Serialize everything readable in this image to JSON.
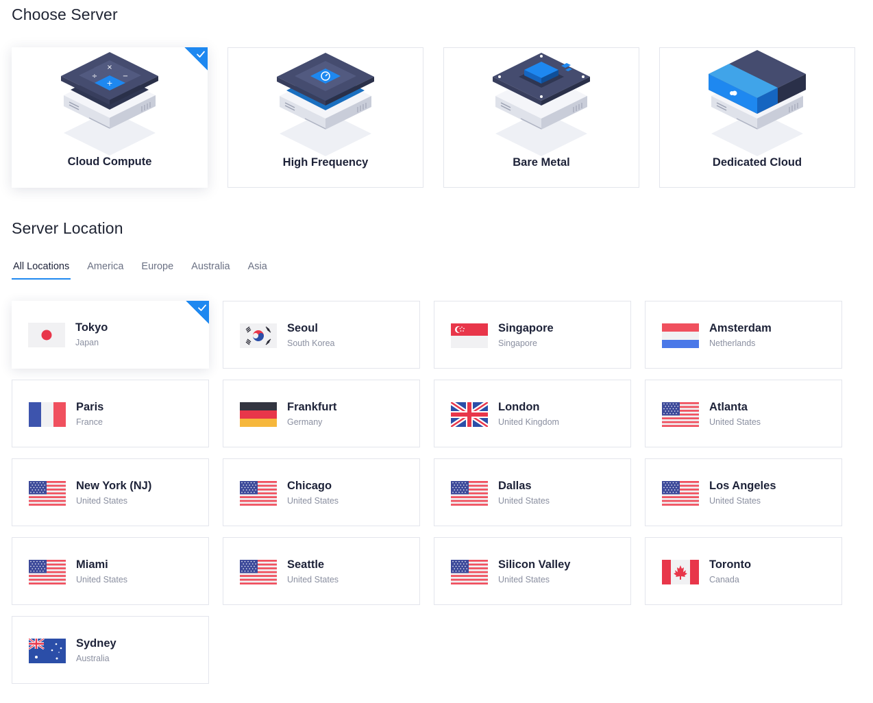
{
  "server_section": {
    "title": "Choose Server",
    "types": [
      {
        "label": "Cloud Compute",
        "selected": true
      },
      {
        "label": "High Frequency",
        "selected": false
      },
      {
        "label": "Bare Metal",
        "selected": false
      },
      {
        "label": "Dedicated Cloud",
        "selected": false
      }
    ]
  },
  "location_section": {
    "title": "Server Location",
    "tabs": [
      "All Locations",
      "America",
      "Europe",
      "Australia",
      "Asia"
    ],
    "active_tab": "All Locations",
    "locations": [
      {
        "city": "Tokyo",
        "country": "Japan",
        "flag": "jp-flag-icon",
        "selected": true
      },
      {
        "city": "Seoul",
        "country": "South Korea",
        "flag": "kr-flag-icon",
        "selected": false
      },
      {
        "city": "Singapore",
        "country": "Singapore",
        "flag": "sg-flag-icon",
        "selected": false
      },
      {
        "city": "Amsterdam",
        "country": "Netherlands",
        "flag": "nl-flag-icon",
        "selected": false
      },
      {
        "city": "Paris",
        "country": "France",
        "flag": "fr-flag-icon",
        "selected": false
      },
      {
        "city": "Frankfurt",
        "country": "Germany",
        "flag": "de-flag-icon",
        "selected": false
      },
      {
        "city": "London",
        "country": "United Kingdom",
        "flag": "gb-flag-icon",
        "selected": false
      },
      {
        "city": "Atlanta",
        "country": "United States",
        "flag": "us-flag-icon",
        "selected": false
      },
      {
        "city": "New York (NJ)",
        "country": "United States",
        "flag": "us-flag-icon",
        "selected": false
      },
      {
        "city": "Chicago",
        "country": "United States",
        "flag": "us-flag-icon",
        "selected": false
      },
      {
        "city": "Dallas",
        "country": "United States",
        "flag": "us-flag-icon",
        "selected": false
      },
      {
        "city": "Los Angeles",
        "country": "United States",
        "flag": "us-flag-icon",
        "selected": false
      },
      {
        "city": "Miami",
        "country": "United States",
        "flag": "us-flag-icon",
        "selected": false
      },
      {
        "city": "Seattle",
        "country": "United States",
        "flag": "us-flag-icon",
        "selected": false
      },
      {
        "city": "Silicon Valley",
        "country": "United States",
        "flag": "us-flag-icon",
        "selected": false
      },
      {
        "city": "Toronto",
        "country": "Canada",
        "flag": "ca-flag-icon",
        "selected": false
      },
      {
        "city": "Sydney",
        "country": "Australia",
        "flag": "au-flag-icon",
        "selected": false
      }
    ]
  },
  "colors": {
    "accent": "#1e88f0",
    "text": "#1d2238",
    "muted": "#8a8fa0",
    "border": "#e3e5ec"
  }
}
